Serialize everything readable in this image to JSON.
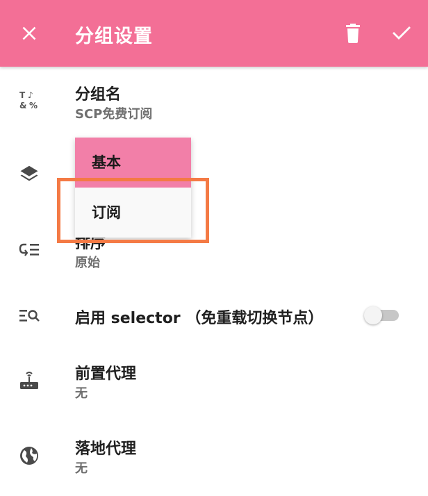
{
  "appbar": {
    "title": "分组设置",
    "close_icon": "close-icon",
    "delete_icon": "delete-icon",
    "save_icon": "check-icon"
  },
  "rows": {
    "group_name": {
      "title": "分组名",
      "value": "SCP免费订阅",
      "icon": "text-format-icon"
    },
    "group_type": {
      "icon": "layers-icon"
    },
    "sort": {
      "title": "排序",
      "value": "原始",
      "icon": "sort-icon"
    },
    "selector": {
      "title": "启用 selector （免重载切换节点）",
      "enabled": false,
      "icon": "filter-search-icon"
    },
    "front_proxy": {
      "title": "前置代理",
      "value": "无",
      "icon": "router-icon"
    },
    "landing_proxy": {
      "title": "落地代理",
      "value": "无",
      "icon": "globe-icon"
    }
  },
  "type_menu": {
    "options": [
      "基本",
      "订阅"
    ],
    "selected": "基本",
    "highlighted": "订阅"
  },
  "colors": {
    "appbar": "#f36f96",
    "menu_selected": "#f27fa8",
    "highlight_box": "#f47a45"
  }
}
